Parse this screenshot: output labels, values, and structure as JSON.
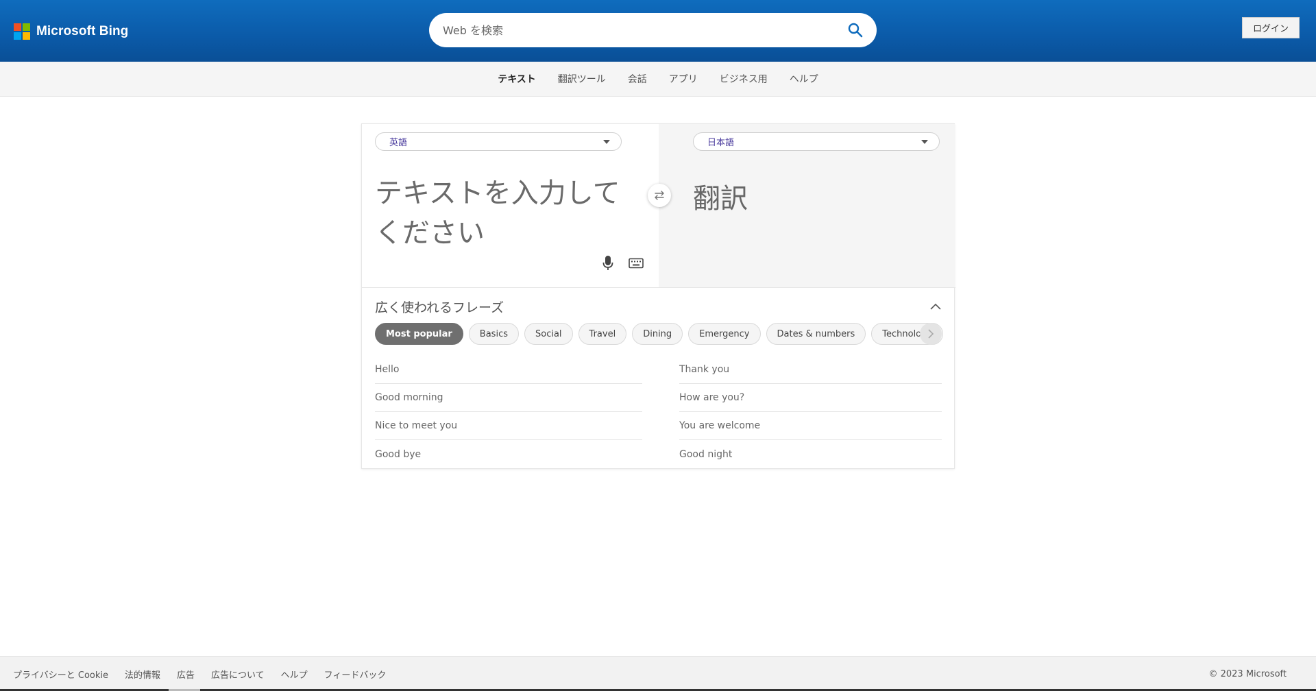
{
  "header": {
    "logo_text": "Microsoft Bing",
    "logo_colors": [
      "#f25022",
      "#7fba00",
      "#00a4ef",
      "#ffb900"
    ],
    "search_placeholder": "Web を検索",
    "login_label": "ログイン",
    "brand_color": "#0f6cbd"
  },
  "nav": {
    "items": [
      "テキスト",
      "翻訳ツール",
      "会話",
      "アプリ",
      "ビジネス用",
      "ヘルプ"
    ]
  },
  "translator": {
    "source_lang": "英語",
    "target_lang": "日本語",
    "source_placeholder": "テキストを入力してください",
    "target_text": "翻訳",
    "icons": [
      "microphone-icon",
      "keyboard-icon",
      "swap-icon"
    ]
  },
  "phrases": {
    "title": "広く使われるフレーズ",
    "categories": [
      "Most popular",
      "Basics",
      "Social",
      "Travel",
      "Dining",
      "Emergency",
      "Dates & numbers",
      "Technology"
    ],
    "active_category": "Most popular",
    "left": [
      "Hello",
      "Good morning",
      "Nice to meet you",
      "Good bye"
    ],
    "right": [
      "Thank you",
      "How are you?",
      "You are welcome",
      "Good night"
    ]
  },
  "footer": {
    "links": [
      "プライバシーと Cookie",
      "法的情報",
      "広告",
      "広告について",
      "ヘルプ",
      "フィードバック"
    ],
    "copyright": "© 2023 Microsoft"
  }
}
